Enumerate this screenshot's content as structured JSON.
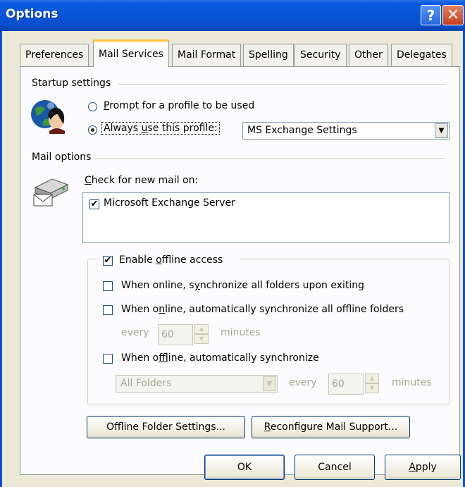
{
  "window": {
    "title": "Options"
  },
  "titlebar": {
    "help_glyph": "?",
    "close_glyph": "✕"
  },
  "tabs": [
    {
      "label": "Preferences"
    },
    {
      "label": "Mail Services",
      "active": true
    },
    {
      "label": "Mail Format"
    },
    {
      "label": "Spelling"
    },
    {
      "label": "Security"
    },
    {
      "label": "Other"
    },
    {
      "label": "Delegates"
    }
  ],
  "startup": {
    "group_label": "Startup settings",
    "icon": "globe-person-icon",
    "prompt_radio": {
      "label_u": "P",
      "label_rest": "rompt for a profile to be used",
      "checked": false
    },
    "always_radio": {
      "label_pre": "Always ",
      "label_u": "u",
      "label_rest": "se this profile:",
      "checked": true
    },
    "profile_select": {
      "value": "MS Exchange Settings"
    }
  },
  "mail_options": {
    "group_label": "Mail options",
    "icon": "mail-server-icon",
    "check_label_u": "C",
    "check_label_rest": "heck for new mail on:",
    "services": [
      {
        "label": "Microsoft Exchange Server",
        "checked": true
      }
    ]
  },
  "offline": {
    "enable": {
      "label_pre": "Enable ",
      "label_u": "o",
      "label_rest": "ffline access",
      "checked": true
    },
    "sync_on_exit": {
      "label_pre": "When online, s",
      "label_u": "y",
      "label_rest": "nchronize all folders upon exiting",
      "checked": false
    },
    "auto_sync_online": {
      "label_pre": "When o",
      "label_u": "n",
      "label_rest": "line, automatically synchronize all offline folders",
      "checked": false
    },
    "online_every": {
      "every_label": "every",
      "value": "60",
      "unit_label": "minutes"
    },
    "auto_sync_offline": {
      "label_pre": "When o",
      "label_u": "f",
      "label_rest": "fline, automatically synchronize",
      "checked": false
    },
    "offline_folders": {
      "value": "All Folders"
    },
    "offline_every": {
      "every_label": "every",
      "value": "60",
      "unit_label": "minutes"
    }
  },
  "buttons": {
    "offline_folder_settings": "Offline Folder Settings...",
    "reconfigure_pre": "",
    "reconfigure_u": "R",
    "reconfigure_rest": "econfigure Mail Support...",
    "ok": "OK",
    "cancel": "Cancel",
    "apply_u": "A",
    "apply_rest": "pply"
  },
  "glyphs": {
    "check": "✔",
    "down_arrow": "▼",
    "up_small": "▲",
    "down_small": "▼"
  }
}
